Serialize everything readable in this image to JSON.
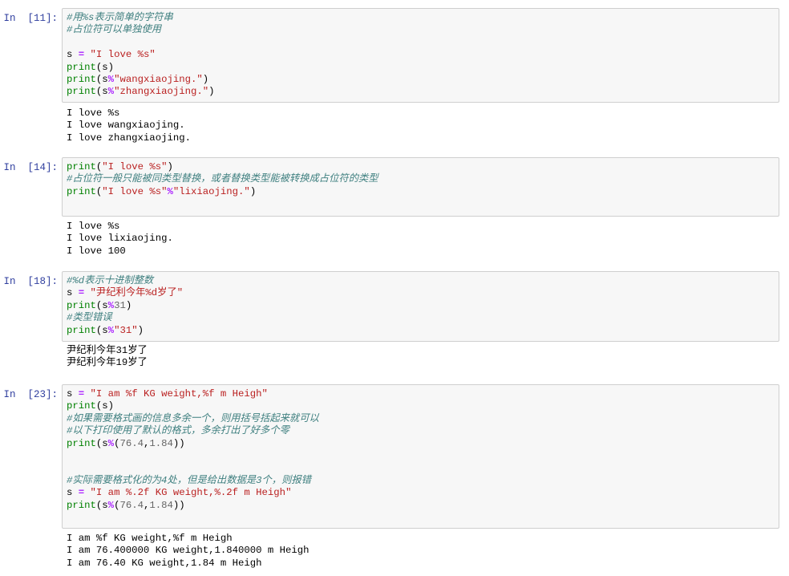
{
  "cells": [
    {
      "prompt": "In  [11]:",
      "code": [
        [
          {
            "t": "cmt",
            "v": "#用%s表示简单的字符串"
          }
        ],
        [
          {
            "t": "cmt",
            "v": "#占位符可以单独使用"
          }
        ],
        [],
        [
          {
            "t": "pl",
            "v": "s "
          },
          {
            "t": "op",
            "v": "="
          },
          {
            "t": "pl",
            "v": " "
          },
          {
            "t": "str",
            "v": "\"I love %s\""
          }
        ],
        [
          {
            "t": "bi",
            "v": "print"
          },
          {
            "t": "pl",
            "v": "(s)"
          }
        ],
        [
          {
            "t": "bi",
            "v": "print"
          },
          {
            "t": "pl",
            "v": "(s"
          },
          {
            "t": "op",
            "v": "%"
          },
          {
            "t": "str",
            "v": "\"wangxiaojing.\""
          },
          {
            "t": "pl",
            "v": ")"
          }
        ],
        [
          {
            "t": "bi",
            "v": "print"
          },
          {
            "t": "pl",
            "v": "(s"
          },
          {
            "t": "op",
            "v": "%"
          },
          {
            "t": "str",
            "v": "\"zhangxiaojing.\""
          },
          {
            "t": "pl",
            "v": ")"
          }
        ]
      ],
      "output": [
        "I love %s",
        "I love wangxiaojing.",
        "I love zhangxiaojing."
      ]
    },
    {
      "prompt": "In  [14]:",
      "code": [
        [
          {
            "t": "bi",
            "v": "print"
          },
          {
            "t": "pl",
            "v": "("
          },
          {
            "t": "str",
            "v": "\"I love %s\""
          },
          {
            "t": "pl",
            "v": ")"
          }
        ],
        [
          {
            "t": "cmt",
            "v": "#占位符一般只能被同类型替换，或者替换类型能被转换成占位符的类型"
          }
        ],
        [
          {
            "t": "bi",
            "v": "print"
          },
          {
            "t": "pl",
            "v": "("
          },
          {
            "t": "str",
            "v": "\"I love %s\""
          },
          {
            "t": "op",
            "v": "%"
          },
          {
            "t": "str",
            "v": "\"lixiaojing.\""
          },
          {
            "t": "pl",
            "v": ")"
          }
        ],
        []
      ],
      "output": [
        "I love %s",
        "I love lixiaojing.",
        "I love 100"
      ]
    },
    {
      "prompt": "In  [18]:",
      "code": [
        [
          {
            "t": "cmt",
            "v": "#%d表示十进制整数"
          }
        ],
        [
          {
            "t": "pl",
            "v": "s "
          },
          {
            "t": "op",
            "v": "="
          },
          {
            "t": "pl",
            "v": " "
          },
          {
            "t": "str",
            "v": "\"尹纪利今年%d岁了\""
          }
        ],
        [
          {
            "t": "bi",
            "v": "print"
          },
          {
            "t": "pl",
            "v": "(s"
          },
          {
            "t": "op",
            "v": "%"
          },
          {
            "t": "num",
            "v": "31"
          },
          {
            "t": "pl",
            "v": ")"
          }
        ],
        [
          {
            "t": "cmt",
            "v": "#类型错误"
          }
        ],
        [
          {
            "t": "bi",
            "v": "print"
          },
          {
            "t": "pl",
            "v": "(s"
          },
          {
            "t": "op",
            "v": "%"
          },
          {
            "t": "str",
            "v": "\"31\""
          },
          {
            "t": "pl",
            "v": ")"
          }
        ]
      ],
      "output": [
        "尹纪利今年31岁了",
        "尹纪利今年19岁了"
      ]
    },
    {
      "prompt": "In  [23]:",
      "code": [
        [
          {
            "t": "pl",
            "v": "s "
          },
          {
            "t": "op",
            "v": "="
          },
          {
            "t": "pl",
            "v": " "
          },
          {
            "t": "str",
            "v": "\"I am %f KG weight,%f m Heigh\""
          }
        ],
        [
          {
            "t": "bi",
            "v": "print"
          },
          {
            "t": "pl",
            "v": "(s)"
          }
        ],
        [
          {
            "t": "cmt",
            "v": "#如果需要格式画的信息多余一个，则用括号括起来就可以"
          }
        ],
        [
          {
            "t": "cmt",
            "v": "#以下打印使用了默认的格式，多余打出了好多个零"
          }
        ],
        [
          {
            "t": "bi",
            "v": "print"
          },
          {
            "t": "pl",
            "v": "(s"
          },
          {
            "t": "op",
            "v": "%"
          },
          {
            "t": "pl",
            "v": "("
          },
          {
            "t": "num",
            "v": "76.4"
          },
          {
            "t": "pl",
            "v": ","
          },
          {
            "t": "num",
            "v": "1.84"
          },
          {
            "t": "pl",
            "v": "))"
          }
        ],
        [],
        [],
        [
          {
            "t": "cmt",
            "v": "#实际需要格式化的为4处，但是给出数据是3个，则报错"
          }
        ],
        [
          {
            "t": "pl",
            "v": "s "
          },
          {
            "t": "op",
            "v": "="
          },
          {
            "t": "pl",
            "v": " "
          },
          {
            "t": "str",
            "v": "\"I am %.2f KG weight,%.2f m Heigh\""
          }
        ],
        [
          {
            "t": "bi",
            "v": "print"
          },
          {
            "t": "pl",
            "v": "(s"
          },
          {
            "t": "op",
            "v": "%"
          },
          {
            "t": "pl",
            "v": "("
          },
          {
            "t": "num",
            "v": "76.4"
          },
          {
            "t": "pl",
            "v": ","
          },
          {
            "t": "num",
            "v": "1.84"
          },
          {
            "t": "pl",
            "v": "))"
          }
        ],
        [],
        []
      ],
      "output": [
        "I am %f KG weight,%f m Heigh",
        "I am 76.400000 KG weight,1.840000 m Heigh",
        "I am 76.40 KG weight,1.84 m Heigh"
      ]
    }
  ]
}
